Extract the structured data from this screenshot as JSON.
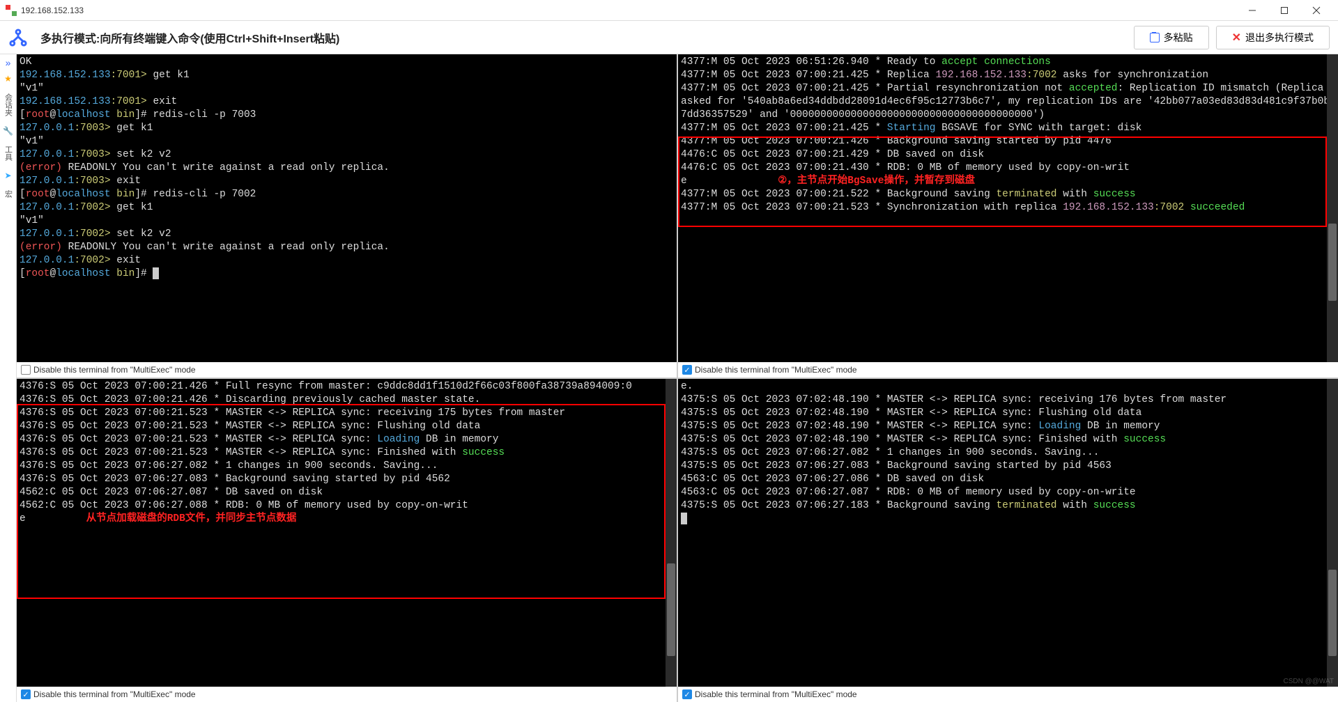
{
  "window": {
    "title": "192.168.152.133",
    "mode_text": "多执行模式:向所有终端键入命令(使用Ctrl+Shift+Insert粘贴)",
    "paste_btn": "多粘贴",
    "exit_btn": "退出多执行模式"
  },
  "left": {
    "tab1": "会话夹",
    "tab2": "工具",
    "tab3": "宏"
  },
  "checkbox_label": "Disable this terminal from \"MultiExec\" mode",
  "watermark": "CSDN @@WAT",
  "annotation_tr": "②，主节点开始BgSave操作，并暂存到磁盘",
  "annotation_bl": "从节点加载磁盘的RDB文件，并同步主节点数据",
  "panes": {
    "tl": [
      {
        "t": "plain",
        "v": "OK"
      },
      {
        "t": "prompt1",
        "ip": "192.168.152.133",
        "port": ":7001>",
        "cmd": " get k1"
      },
      {
        "t": "plain",
        "v": "\"v1\""
      },
      {
        "t": "prompt1",
        "ip": "192.168.152.133",
        "port": ":7001>",
        "cmd": " exit"
      },
      {
        "t": "root",
        "cmd": "redis-cli -p 7003"
      },
      {
        "t": "prompt1",
        "ip": "127.0.0.1",
        "port": ":7003>",
        "cmd": " get k1"
      },
      {
        "t": "plain",
        "v": "\"v1\""
      },
      {
        "t": "prompt1",
        "ip": "127.0.0.1",
        "port": ":7003>",
        "cmd": " set k2 v2"
      },
      {
        "t": "err",
        "v": "(error) ",
        "rest": "READONLY You can't write against a read only replica."
      },
      {
        "t": "prompt1",
        "ip": "127.0.0.1",
        "port": ":7003>",
        "cmd": " exit"
      },
      {
        "t": "root",
        "cmd": "redis-cli -p 7002"
      },
      {
        "t": "prompt1",
        "ip": "127.0.0.1",
        "port": ":7002>",
        "cmd": " get k1"
      },
      {
        "t": "plain",
        "v": "\"v1\""
      },
      {
        "t": "prompt1",
        "ip": "127.0.0.1",
        "port": ":7002>",
        "cmd": " set k2 v2"
      },
      {
        "t": "err",
        "v": "(error) ",
        "rest": "READONLY You can't write against a read only replica."
      },
      {
        "t": "prompt1",
        "ip": "127.0.0.1",
        "port": ":7002>",
        "cmd": " exit"
      },
      {
        "t": "root",
        "cmd": "",
        "cursor": true
      }
    ],
    "tr": [
      "4377:M 05 Oct 2023 06:51:26.940 * Ready to accept connections",
      "4377:M 05 Oct 2023 07:00:21.425 * Replica 192.168.152.133:7002 asks for synchronization",
      "4377:M 05 Oct 2023 07:00:21.425 * Partial resynchronization not accepted: Replication ID mismatch (Replica asked for '540ab8a6ed34ddbdd28091d4ec6f95c12773b6c7', my replication IDs are '42bb077a03ed83d83d481c9f37b0b7dd36357529' and '0000000000000000000000000000000000000000')",
      "4377:M 05 Oct 2023 07:00:21.425 * Starting BGSAVE for SYNC with target: disk",
      "4377:M 05 Oct 2023 07:00:21.426 * Background saving started by pid 4476",
      "4476:C 05 Oct 2023 07:00:21.429 * DB saved on disk",
      "4476:C 05 Oct 2023 07:00:21.430 * RDB: 0 MB of memory used by copy-on-write",
      "4377:M 05 Oct 2023 07:00:21.522 * Background saving terminated with success",
      "4377:M 05 Oct 2023 07:00:21.523 * Synchronization with replica 192.168.152.133:7002 succeeded"
    ],
    "bl": [
      "4376:S 05 Oct 2023 07:00:21.426 * Full resync from master: c9ddc8dd1f1510d2f66c03f800fa38739a894009:0",
      "4376:S 05 Oct 2023 07:00:21.426 * Discarding previously cached master state.",
      "4376:S 05 Oct 2023 07:00:21.523 * MASTER <-> REPLICA sync: receiving 175 bytes from master",
      "4376:S 05 Oct 2023 07:00:21.523 * MASTER <-> REPLICA sync: Flushing old data",
      "4376:S 05 Oct 2023 07:00:21.523 * MASTER <-> REPLICA sync: Loading DB in memory",
      "4376:S 05 Oct 2023 07:00:21.523 * MASTER <-> REPLICA sync: Finished with success",
      "4376:S 05 Oct 2023 07:06:27.082 * 1 changes in 900 seconds. Saving...",
      "4376:S 05 Oct 2023 07:06:27.083 * Background saving started by pid 4562",
      "4562:C 05 Oct 2023 07:06:27.087 * DB saved on disk",
      "4562:C 05 Oct 2023 07:06:27.088 * RDB: 0 MB of memory used by copy-on-write"
    ],
    "br": [
      "e.",
      "4375:S 05 Oct 2023 07:02:48.190 * MASTER <-> REPLICA sync: receiving 176 bytes from master",
      "4375:S 05 Oct 2023 07:02:48.190 * MASTER <-> REPLICA sync: Flushing old data",
      "4375:S 05 Oct 2023 07:02:48.190 * MASTER <-> REPLICA sync: Loading DB in memory",
      "4375:S 05 Oct 2023 07:02:48.190 * MASTER <-> REPLICA sync: Finished with success",
      "4375:S 05 Oct 2023 07:06:27.082 * 1 changes in 900 seconds. Saving...",
      "4375:S 05 Oct 2023 07:06:27.083 * Background saving started by pid 4563",
      "4563:C 05 Oct 2023 07:06:27.086 * DB saved on disk",
      "4563:C 05 Oct 2023 07:06:27.087 * RDB: 0 MB of memory used by copy-on-write",
      "4375:S 05 Oct 2023 07:06:27.183 * Background saving terminated with success"
    ]
  }
}
